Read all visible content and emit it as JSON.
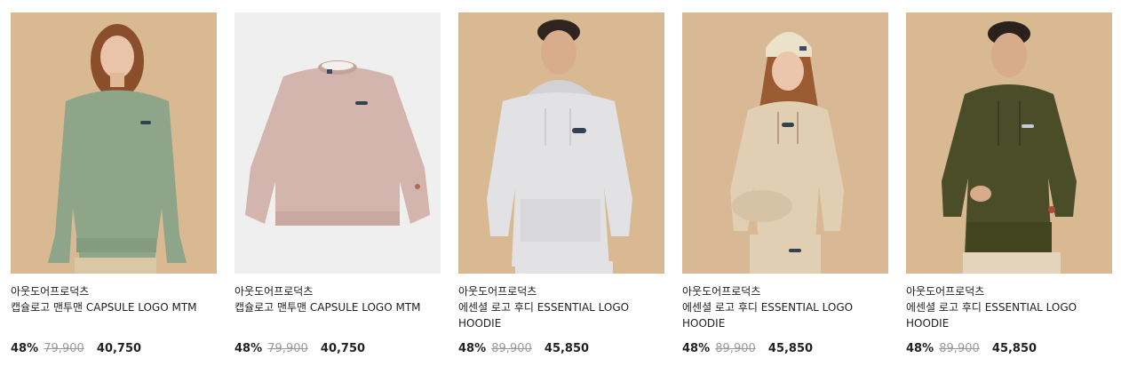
{
  "products": [
    {
      "brand": "아웃도어프로덕츠",
      "name": "캡슐로고 맨투맨 CAPSULE LOGO MTM",
      "discount": "48%",
      "original_price": "79,900",
      "sale_price": "40,750",
      "bg": "#d8b992",
      "garment": "#8fa58a",
      "model": "female-sweatshirt"
    },
    {
      "brand": "아웃도어프로덕츠",
      "name": "캡슐로고 맨투맨 CAPSULE LOGO MTM",
      "discount": "48%",
      "original_price": "79,900",
      "sale_price": "40,750",
      "bg": "#efefef",
      "garment": "#d3b5ad",
      "model": "flatlay-sweatshirt"
    },
    {
      "brand": "아웃도어프로덕츠",
      "name": "에센셜 로고 후디 ESSENTIAL LOGO HOODIE",
      "discount": "48%",
      "original_price": "89,900",
      "sale_price": "45,850",
      "bg": "#d8b992",
      "garment": "#e2e1e4",
      "model": "male-hoodie"
    },
    {
      "brand": "아웃도어프로덕츠",
      "name": "에센셜 로고 후디 ESSENTIAL LOGO HOODIE",
      "discount": "48%",
      "original_price": "89,900",
      "sale_price": "45,850",
      "bg": "#d9b995",
      "garment": "#e1cfb3",
      "model": "female-hoodie"
    },
    {
      "brand": "아웃도어프로덕츠",
      "name": "에센셜 로고 후디 ESSENTIAL LOGO HOODIE",
      "discount": "48%",
      "original_price": "89,900",
      "sale_price": "45,850",
      "bg": "#d8b992",
      "garment": "#4a4d28",
      "model": "male-hoodie"
    }
  ]
}
